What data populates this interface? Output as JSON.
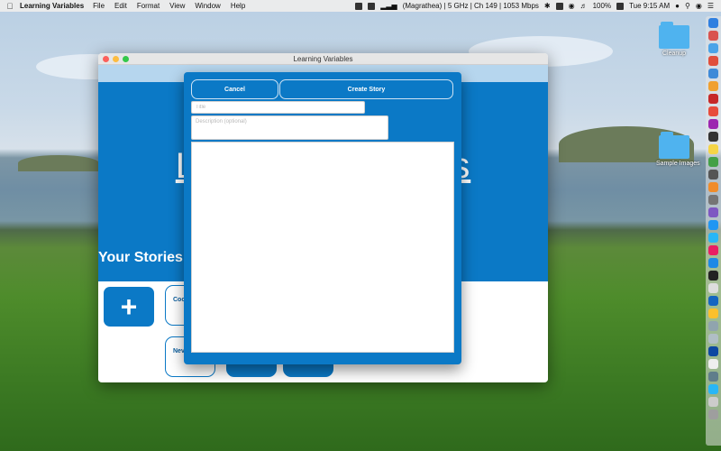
{
  "menubar": {
    "app_name": "Learning Variables",
    "menus": [
      "File",
      "Edit",
      "Format",
      "View",
      "Window",
      "Help"
    ],
    "wifi_status": "(Magrathea) | 5 GHz | Ch 149 | 1053 Mbps",
    "battery": "100%",
    "clock": "Tue 9:15 AM"
  },
  "desktop": {
    "folders": [
      {
        "label": "Cleanup"
      },
      {
        "label": "Sample Images"
      }
    ]
  },
  "window": {
    "title": "Learning Variables",
    "hero_title": "Learning Variables",
    "hero_title_visible_left": "Le",
    "hero_title_visible_right": "s",
    "section_title": "Your Stories",
    "add_label": "+",
    "story_cards": [
      {
        "label": "Coo"
      },
      {
        "label": "Nev"
      }
    ]
  },
  "sheet": {
    "cancel_label": "Cancel",
    "create_label": "Create Story",
    "title_placeholder": "Title",
    "title_value": "",
    "description_placeholder": "Description (optional)",
    "description_value": ""
  },
  "colors": {
    "accent": "#0b79c6",
    "sheet_border": "#cfe3f4",
    "window_strip": "#b6d6ee"
  }
}
